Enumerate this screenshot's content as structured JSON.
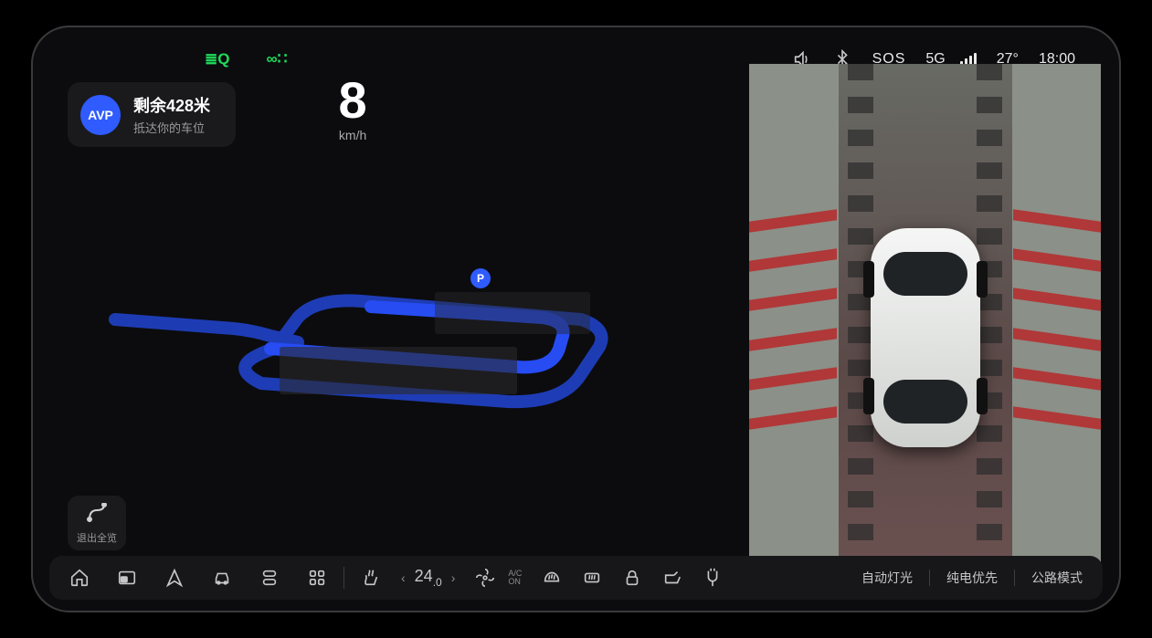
{
  "statusbar": {
    "left_indicators": [
      "≣Q",
      "∞∷"
    ],
    "sos": "SOS",
    "network": "5G",
    "temperature": "27°",
    "time": "18:00"
  },
  "avp": {
    "badge": "AVP",
    "line1": "剩余428米",
    "line2": "抵达你的车位"
  },
  "speed": {
    "value": "8",
    "unit": "km/h"
  },
  "parking_marker_label": "P",
  "exit_button": {
    "label": "退出全览"
  },
  "dock": {
    "climate_temp_int": "24",
    "climate_temp_dec": ".0",
    "ac_top": "A/C",
    "ac_bottom": "ON",
    "mode_auto_light": "自动灯光",
    "mode_ev_priority": "纯电优先",
    "mode_road": "公路模式"
  }
}
